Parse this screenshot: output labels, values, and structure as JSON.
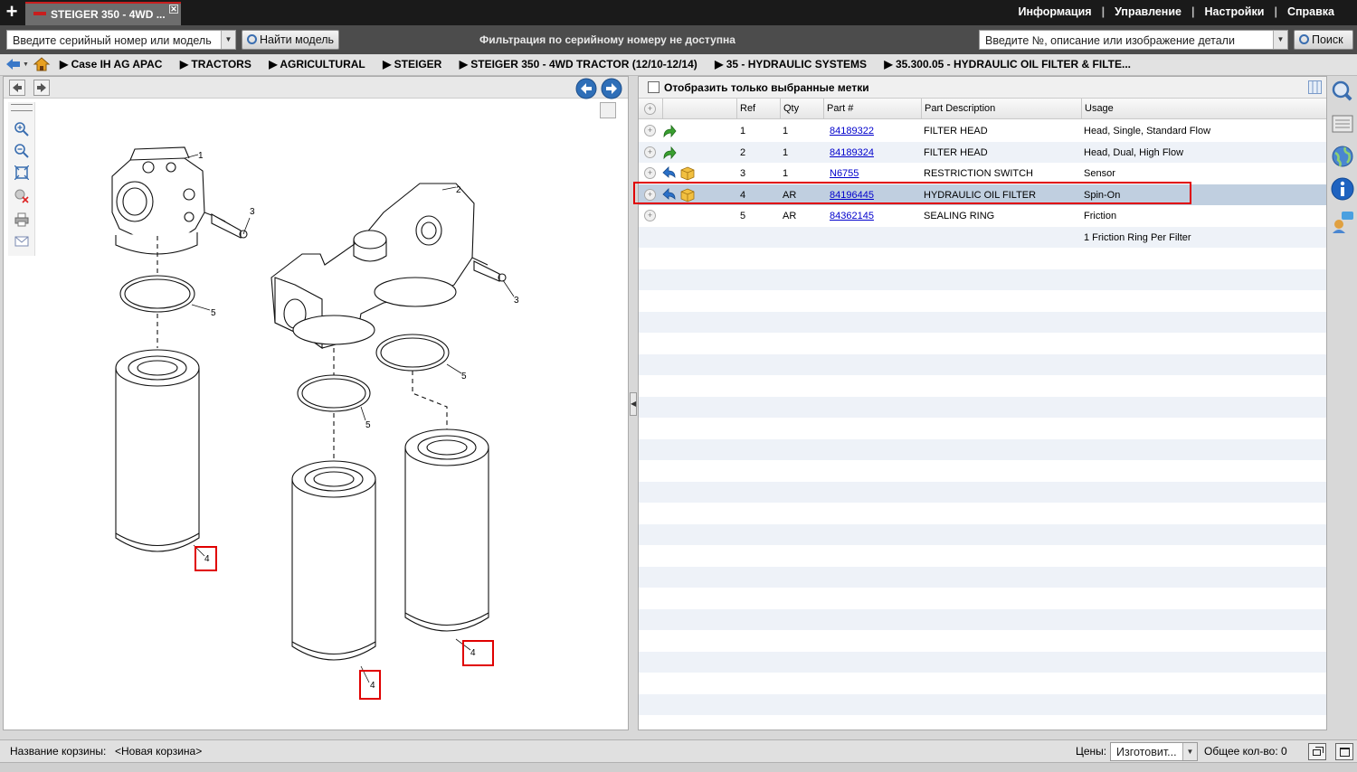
{
  "tabs": [
    {
      "title": "STEIGER 350 - 4WD ..."
    }
  ],
  "top_menu": [
    "Информация",
    "Управление",
    "Настройки",
    "Справка"
  ],
  "search": {
    "serial_placeholder": "Введите серийный номер или модель",
    "find_model_label": "Найти модель",
    "filter_message": "Фильтрация по серийному номеру не доступна",
    "part_placeholder": "Введите №, описание или изображение детали",
    "search_label": "Поиск"
  },
  "breadcrumb": [
    "Case IH AG APAC",
    "TRACTORS",
    "AGRICULTURAL",
    "STEIGER",
    "STEIGER 350 - 4WD TRACTOR (12/10-12/14)",
    "35 - HYDRAULIC SYSTEMS",
    "35.300.05 - HYDRAULIC OIL FILTER & FILTE..."
  ],
  "parts_panel": {
    "show_selected_label": "Отобразить только выбранные метки",
    "columns": [
      "Ref",
      "Qty",
      "Part #",
      "Part Description",
      "Usage"
    ],
    "rows": [
      {
        "ref": "1",
        "qty": "1",
        "part": "84189322",
        "desc": "FILTER HEAD",
        "usage": "Head, Single, Standard Flow",
        "icons": [
          "arrow-green-icon"
        ]
      },
      {
        "ref": "2",
        "qty": "1",
        "part": "84189324",
        "desc": "FILTER HEAD",
        "usage": "Head, Dual, High Flow",
        "icons": [
          "arrow-green-icon"
        ]
      },
      {
        "ref": "3",
        "qty": "1",
        "part": "N6755",
        "desc": "RESTRICTION SWITCH",
        "usage": "Sensor",
        "icons": [
          "arrow-blue-icon",
          "box-icon"
        ]
      },
      {
        "ref": "4",
        "qty": "AR",
        "part": "84196445",
        "desc": "HYDRAULIC OIL FILTER",
        "usage": "Spin-On",
        "icons": [
          "arrow-blue-icon",
          "box-icon"
        ],
        "selected": true
      },
      {
        "ref": "5",
        "qty": "AR",
        "part": "84362145",
        "desc": "SEALING RING",
        "usage": "Friction",
        "icons": []
      },
      {
        "ref": "",
        "qty": "",
        "part": "",
        "desc": "",
        "usage": "1 Friction Ring Per Filter",
        "icons": []
      }
    ]
  },
  "diagram": {
    "callouts": [
      "1",
      "2",
      "3",
      "3",
      "4",
      "4",
      "4",
      "5",
      "5",
      "5"
    ]
  },
  "status": {
    "basket_label": "Название корзины:",
    "basket_value": "<Новая корзина>",
    "prices_label": "Цены:",
    "prices_value": "Изготовит...",
    "total_label": "Общее кол-во: 0"
  },
  "colors": {
    "selected_row": "#c0cfe0",
    "highlight": "#e00000",
    "link": "#0000cc",
    "topbar": "#1a1a1a"
  }
}
